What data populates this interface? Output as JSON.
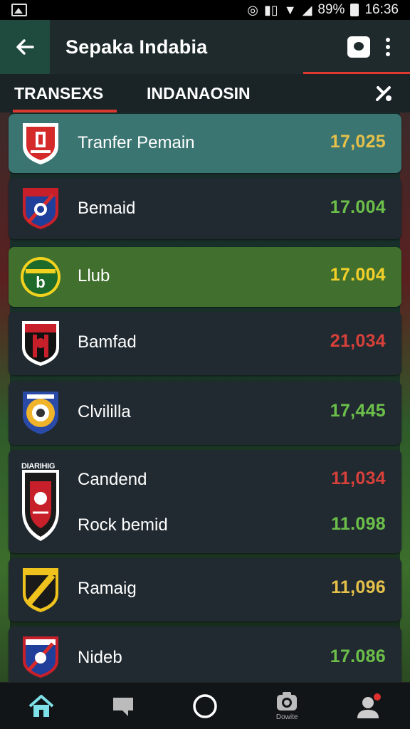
{
  "status_bar": {
    "battery": "89%",
    "time": "16:36"
  },
  "app_bar": {
    "title": "Sepaka Indabia"
  },
  "tabs": [
    {
      "label": "TRANSEXS",
      "active": true
    },
    {
      "label": "INDANAOSIN",
      "active": false
    }
  ],
  "rows": [
    {
      "name": "Tranfer Pemain",
      "value": "17,025",
      "value_color": "#e6c14a",
      "bg": "teal",
      "crest": "red-shield"
    },
    {
      "name": "Bemaid",
      "value": "17.004",
      "value_color": "#6cc04a",
      "bg": "dark",
      "crest": "blue-red-shield"
    },
    {
      "name": "Llub",
      "value": "17.004",
      "value_color": "#f2cf2a",
      "bg": "green",
      "crest": "green-circle"
    },
    {
      "name": "Bamfad",
      "value": "21,034",
      "value_color": "#d8403a",
      "bg": "dark",
      "crest": "red-black-shield"
    },
    {
      "name": "Clvililla",
      "value": "17,445",
      "value_color": "#6cc04a",
      "bg": "dark",
      "crest": "blue-gold-circle"
    },
    {
      "name": "Candend",
      "value": "11,034",
      "value_color": "#d8403a",
      "bg": "dark",
      "crest": "black-red-shield",
      "crest_text": "DIARIHIG"
    },
    {
      "name": "Rock bemid",
      "value": "11.098",
      "value_color": "#6cc04a",
      "bg": "dark"
    },
    {
      "name": "Ramaig",
      "value": "11,096",
      "value_color": "#e6c14a",
      "bg": "dark",
      "crest": "yellow-black-shield"
    },
    {
      "name": "Nideb",
      "value": "17.086",
      "value_color": "#6cc04a",
      "bg": "dark",
      "crest": "blue-red-shield"
    }
  ],
  "bottom_nav": [
    {
      "icon": "home-icon",
      "active": true
    },
    {
      "icon": "chat-icon"
    },
    {
      "icon": "circle-icon"
    },
    {
      "icon": "camera-icon",
      "label": "Dowite"
    },
    {
      "icon": "profile-icon",
      "badge": true
    }
  ]
}
